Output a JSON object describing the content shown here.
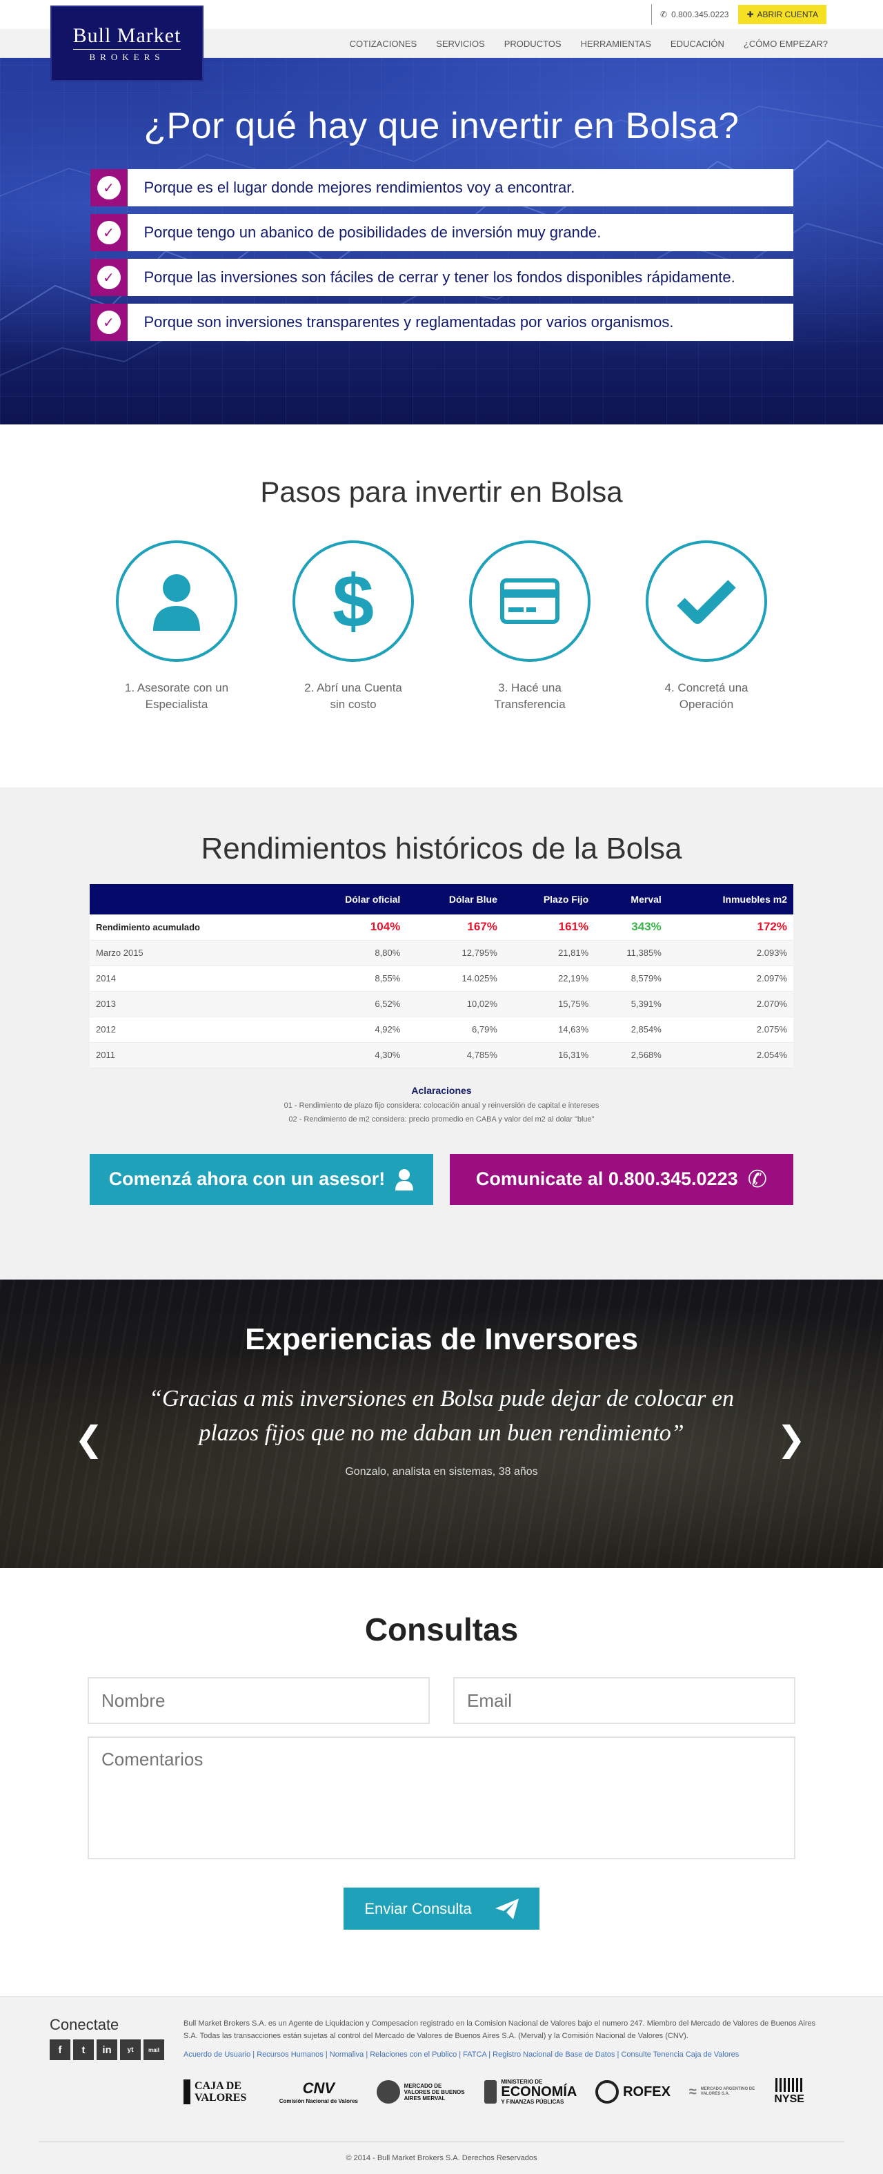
{
  "header": {
    "logo_brand": "Bull Market",
    "logo_sub": "BROKERS",
    "phone": "0.800.345.0223",
    "open_account": "ABRIR CUENTA",
    "nav": [
      "COTIZACIONES",
      "SERVICIOS",
      "PRODUCTOS",
      "HERRAMIENTAS",
      "EDUCACIÓN",
      "¿CÓMO EMPEZAR?"
    ]
  },
  "hero": {
    "title": "¿Por qué hay que invertir en Bolsa?",
    "reasons": [
      "Porque es el lugar donde mejores rendimientos voy a encontrar.",
      "Porque tengo un abanico de posibilidades de inversión muy grande.",
      "Porque las inversiones son fáciles de cerrar y tener los fondos disponibles rápidamente.",
      "Porque son inversiones transparentes y reglamentadas por varios organismos."
    ]
  },
  "steps": {
    "title": "Pasos para invertir en Bolsa",
    "items": [
      {
        "label": "1. Asesorate con un Especialista",
        "icon": "user-icon"
      },
      {
        "label": "2. Abrí una Cuenta sin costo",
        "icon": "dollar-icon"
      },
      {
        "label": "3. Hacé una Transferencia",
        "icon": "credit-card-icon"
      },
      {
        "label": "4. Concretá una Operación",
        "icon": "checkmark-icon"
      }
    ]
  },
  "returns": {
    "title": "Rendimientos históricos de la Bolsa",
    "columns": [
      "",
      "Dólar oficial",
      "Dólar Blue",
      "Plazo Fijo",
      "Merval",
      "Inmuebles m2"
    ],
    "accumulated": {
      "label": "Rendimiento acumulado",
      "values": [
        "104%",
        "167%",
        "161%",
        "343%",
        "172%"
      ]
    },
    "rows": [
      {
        "label": "Marzo 2015",
        "values": [
          "8,80%",
          "12,795%",
          "21,81%",
          "11,385%",
          "2.093%"
        ]
      },
      {
        "label": "2014",
        "values": [
          "8,55%",
          "14.025%",
          "22,19%",
          "8,579%",
          "2.097%"
        ]
      },
      {
        "label": "2013",
        "values": [
          "6,52%",
          "10,02%",
          "15,75%",
          "5,391%",
          "2.070%"
        ]
      },
      {
        "label": "2012",
        "values": [
          "4,92%",
          "6,79%",
          "14,63%",
          "2,854%",
          "2.075%"
        ]
      },
      {
        "label": "2011",
        "values": [
          "4,30%",
          "4,785%",
          "16,31%",
          "2,568%",
          "2.054%"
        ]
      }
    ],
    "notes_title": "Aclaraciones",
    "notes": [
      "01 - Rendimiento de plazo fijo considera: colocación anual y reinversión de capital e intereses",
      "02 - Rendimiento de m2 considera: precio promedio en CABA y valor del m2 al dolar \"blue\""
    ],
    "cta_advisor": "Comenzá ahora con un asesor!",
    "cta_call": "Comunicate al 0.800.345.0223"
  },
  "testimonial": {
    "title": "Experiencias de Inversores",
    "quote": "“Gracias a mis inversiones en Bolsa pude dejar de  colocar en plazos fijos que no me daban un buen rendimiento”",
    "author": "Gonzalo, analista en sistemas, 38 años"
  },
  "consult": {
    "title": "Consultas",
    "name_placeholder": "Nombre",
    "email_placeholder": "Email",
    "comments_placeholder": "Comentarios",
    "submit": "Enviar Consulta"
  },
  "footer": {
    "connect": "Conectate",
    "socials": [
      "f",
      "t",
      "in",
      "yt",
      "mail"
    ],
    "legal": "Bull Market Brokers S.A. es un Agente de Liquidacion y Compesacion registrado en la Comision Nacional de Valores bajo el numero 247. Miembro del Mercado de Valores de Buenos Aires S.A. Todas las transacciones están sujetas al control del Mercado de Valores de Buenos Aires S.A. (Merval) y la Comisión Nacional de Valores (CNV).",
    "links": "Acuerdo de Usuario | Recursos Humanos | Normaliva | Relaciones con el Publico | FATCA | Registro Nacional de Base de Datos | Consulte Tenencia Caja de Valores",
    "logos": {
      "caja": "CAJA DE VALORES",
      "cnv": "CNV",
      "cnv_sub": "Comisión Nacional de Valores",
      "merval": "MERCADO DE VALORES DE BUENOS AIRES MERVAL",
      "economia_top": "MINISTERIO DE",
      "economia": "ECONOMÍA",
      "economia_sub": "Y FINANZAS PÚBLICAS",
      "rofex": "ROFEX",
      "mav": "MERCADO ARGENTINO DE VALORES S.A.",
      "nyse": "NYSE"
    },
    "copyright": "© 2014 - Bull Market Brokers S.A. Derechos Reservados"
  }
}
